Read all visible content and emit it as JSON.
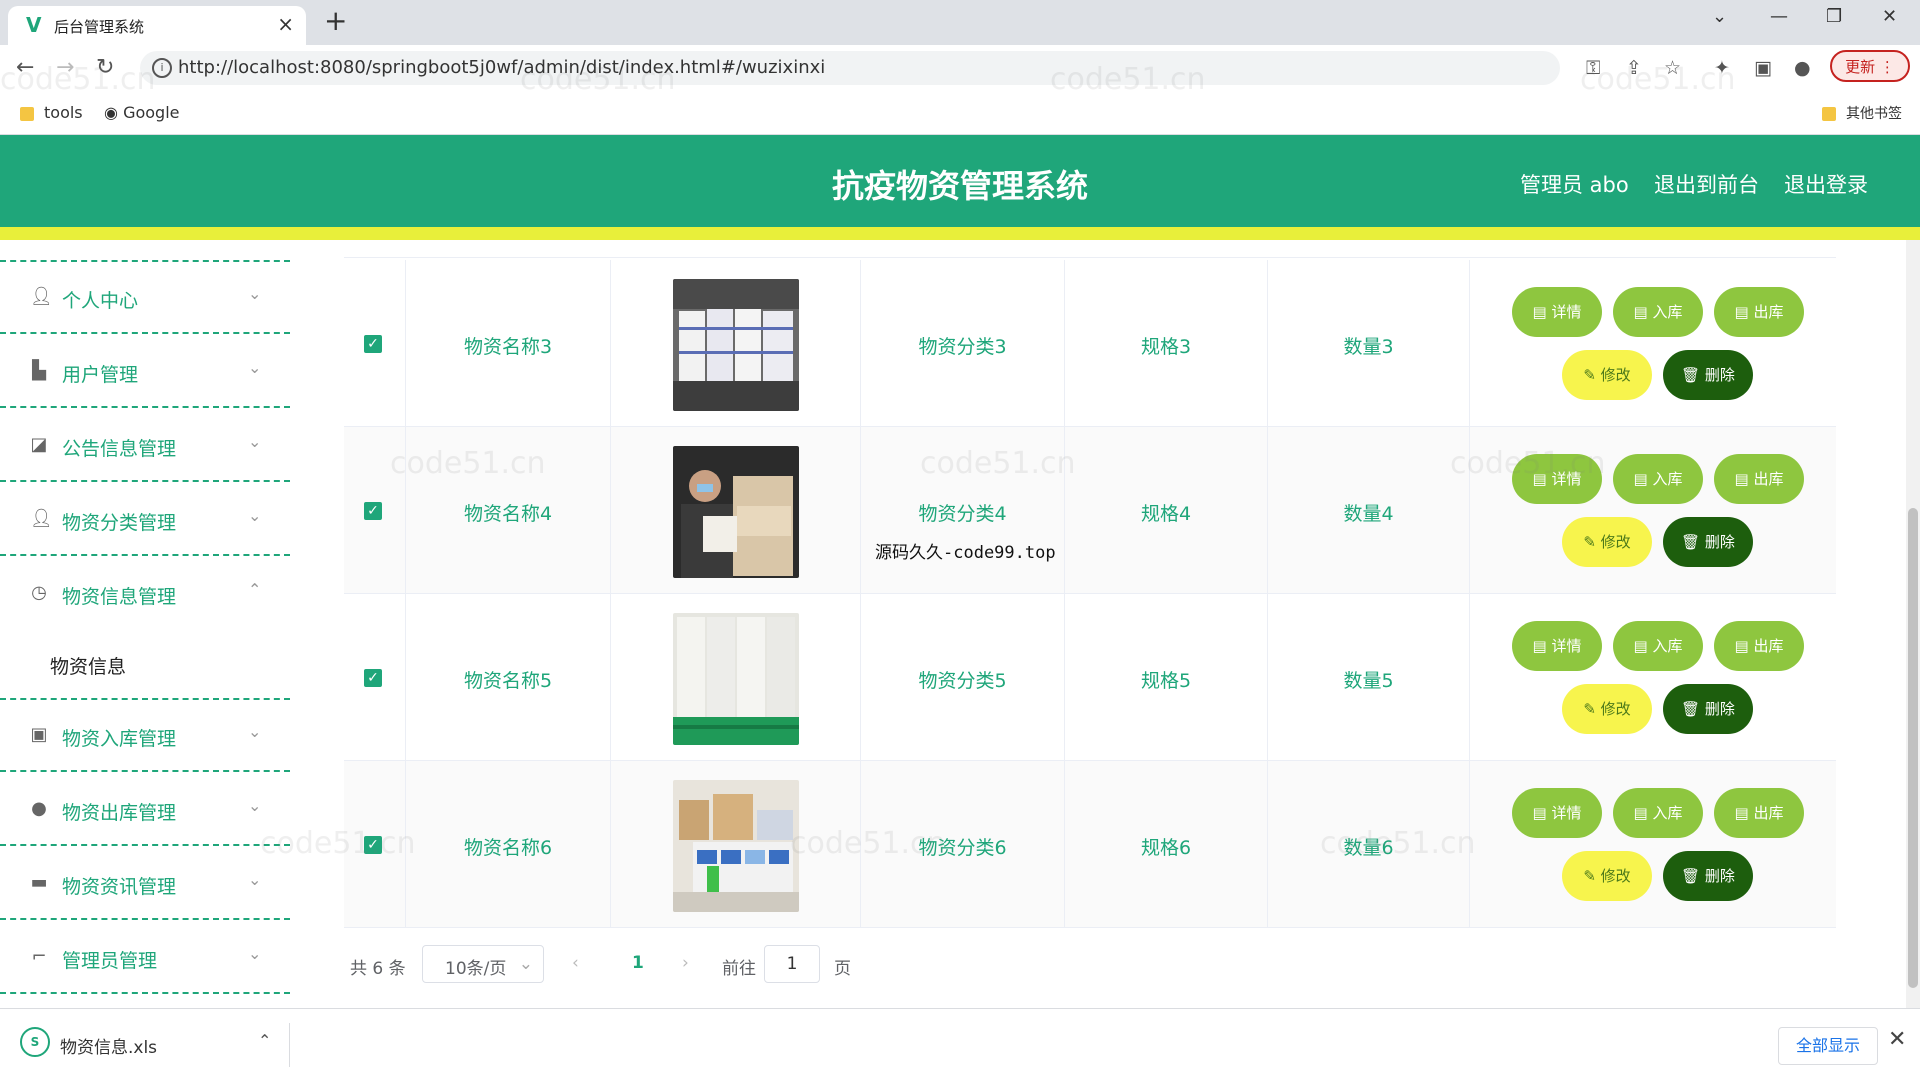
{
  "browser": {
    "tab_title": "后台管理系统",
    "url": "http://localhost:8080/springboot5j0wf/admin/dist/index.html#/wuzixinxi",
    "update_label": "更新",
    "bookmarks": [
      "tools",
      "Google"
    ],
    "other_bookmarks": "其他书签"
  },
  "header": {
    "title": "抗疫物资管理系统",
    "user": "管理员 abo",
    "to_front": "退出到前台",
    "logout": "退出登录"
  },
  "sidebar": {
    "items": [
      {
        "label": "个人中心",
        "icon": "user-icon"
      },
      {
        "label": "用户管理",
        "icon": "users-icon"
      },
      {
        "label": "公告信息管理",
        "icon": "chart-icon"
      },
      {
        "label": "物资分类管理",
        "icon": "user-icon"
      },
      {
        "label": "物资信息管理",
        "icon": "clock-icon"
      },
      {
        "label": "物资入库管理",
        "icon": "clipboard-icon"
      },
      {
        "label": "物资出库管理",
        "icon": "bulb-icon"
      },
      {
        "label": "物资资讯管理",
        "icon": "briefcase-icon"
      },
      {
        "label": "管理员管理",
        "icon": "crop-icon"
      }
    ],
    "active_sub": "物资信息"
  },
  "table": {
    "rows": [
      {
        "name": "物资名称3",
        "category": "物资分类3",
        "spec": "规格3",
        "qty": "数量3"
      },
      {
        "name": "物资名称4",
        "category": "物资分类4",
        "spec": "规格4",
        "qty": "数量4"
      },
      {
        "name": "物资名称5",
        "category": "物资分类5",
        "spec": "规格5",
        "qty": "数量5"
      },
      {
        "name": "物资名称6",
        "category": "物资分类6",
        "spec": "规格6",
        "qty": "数量6"
      }
    ],
    "actions": {
      "detail": "详情",
      "stock_in": "入库",
      "stock_out": "出库",
      "edit": "修改",
      "delete": "删除"
    }
  },
  "pagination": {
    "total": "共 6 条",
    "page_size": "10条/页",
    "current_page": "1",
    "goto_label": "前往",
    "goto_value": "1",
    "page_unit": "页"
  },
  "overlay_notice": "源码久久-code99.top",
  "watermark": "code51.cn",
  "download": {
    "file_name": "物资信息.xls",
    "show_all": "全部显示"
  },
  "colors": {
    "primary": "#1fa67a",
    "accent_yellow": "#e8ef3a",
    "button_green": "#8ec63f",
    "button_yellow": "#f7f44d",
    "button_dark": "#1d5e0d"
  }
}
